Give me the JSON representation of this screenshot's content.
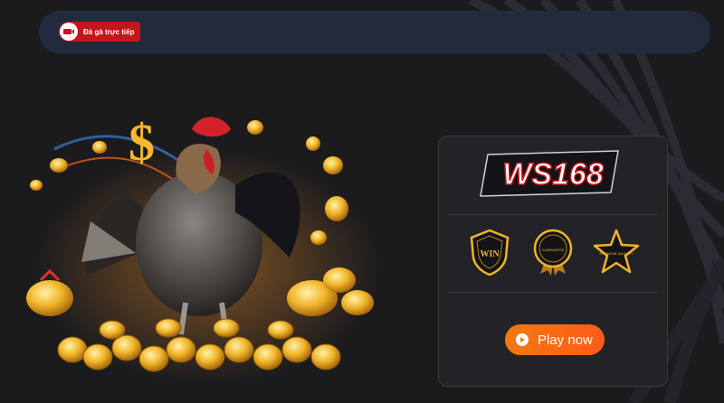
{
  "topbar": {
    "tag_label": "Đá gà trực tiếp",
    "tag_icon": "live-icon"
  },
  "card": {
    "logo_text": "WS168",
    "badges": [
      {
        "name": "win-shield",
        "text": "WIN"
      },
      {
        "name": "guarantee-seal",
        "text": "GUARANTEE"
      },
      {
        "name": "premium-quality-star",
        "text": "PREMIUM QUALITY"
      }
    ],
    "play_label": "Play now"
  },
  "colors": {
    "accent_red": "#c4161c",
    "button_orange": "#f07a10",
    "gold": "#f0b42a",
    "topbar_bg": "#242a3e"
  }
}
